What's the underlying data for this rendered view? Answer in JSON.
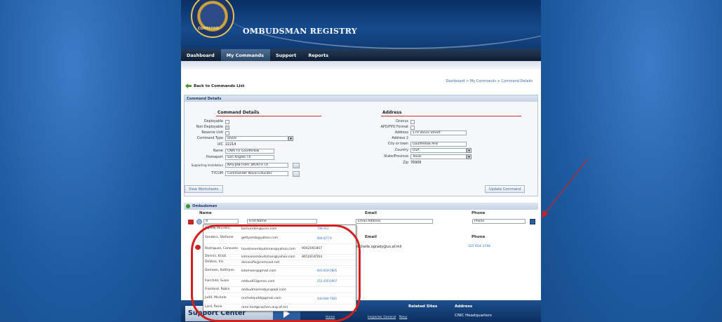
{
  "site": {
    "title": "OMBUDSMAN REGISTRY",
    "seal_text": "COMMAND"
  },
  "nav": {
    "items": [
      "Dashboard",
      "My Commands",
      "Support",
      "Reports"
    ],
    "active": "My Commands"
  },
  "breadcrumb": "Dashboard > My Commands > Command Details",
  "back_link": "Back to Commands List",
  "panel_title": "Command Details",
  "command_details": {
    "section_title": "Command Details",
    "deployable_label": "Deployable",
    "non_deployable_label": "Non-Deployable",
    "reserve_unit_label": "Reserve Unit",
    "command_type_label": "Command Type",
    "command_type_value": "Shore",
    "uic_label": "UIC",
    "uic_value": "22214",
    "name_label": "Name",
    "name_value": "CNATTU Goodfellow",
    "homeport_label": "Homeport",
    "homeport_value": "San Angelo TX",
    "supporting_label": "Supporting Installation",
    "supporting_value": "NAS JRB FORT WORTH TX",
    "tycom_label": "TYCOM",
    "tycom_value": "Commander Naval Educatic"
  },
  "address": {
    "section_title": "Address",
    "oconus_label": "Oconus",
    "apo_label": "APO/FPO Format",
    "address_label": "Address",
    "address_value": "170 Vance Street",
    "address2_label": "Address 2",
    "address2_value": "",
    "city_label": "City or town",
    "city_value": "Goodfellow AFB",
    "country_label": "Country",
    "country_value": "USA",
    "state_label": "State/Province",
    "state_value": "Texas",
    "zip_label": "Zip",
    "zip_value": "76908"
  },
  "buttons": {
    "view_worksheets": "View Worksheets",
    "update_command": "Update Command"
  },
  "ombudsman": {
    "title": "Ombudsman",
    "columns": [
      "Name",
      "Email",
      "Phone"
    ],
    "search_name_value": "d",
    "first_name_placeholder": "First Name",
    "email_placeholder": "Email Address",
    "phone_placeholder": "Phone",
    "existing_email": "michelle.ogrady@us.af.mil",
    "existing_phone": "325 654-3748"
  },
  "dropdown": [
    {
      "name": "Agnew-Munden,",
      "email": "bamunden@juno.com",
      "phone": "798-912"
    },
    {
      "name": "Sanders, Stefanie",
      "email": "gettyomb@yahoo.com",
      "phone": "804-877-9"
    },
    {
      "name": "Rodriguez, Consuela",
      "email": "houstonombudsman@yahoo.com",
      "phone": "9042091857"
    },
    {
      "name": "Dennis, Kristi",
      "email": "kdmoseombudsman@yahoo.com",
      "phone": "8652616564"
    },
    {
      "name": "DeVoss, Iris",
      "email": "devossfis@comcast.net",
      "phone": ""
    },
    {
      "name": "Domsen, Kathlyen",
      "email": "kdomsen@gmail.com",
      "phone": "803-818-0805"
    },
    {
      "name": "Fairchild, Susie",
      "email": "ombud03@msn.com",
      "phone": "251-450-0907"
    },
    {
      "name": "Freeland, Robin",
      "email": "ombudmamrobyn@aol.com",
      "phone": ""
    },
    {
      "name": "Judd, Michele",
      "email": "michelejudd@gmail.com",
      "phone": "540-844-7681"
    },
    {
      "name": "Lord, Rene",
      "email": "rene.lord@cachen.ang.af.mil",
      "phone": ""
    }
  ],
  "footer": {
    "support_center": "Support Center",
    "related_sites": "Related Sites",
    "address_heading": "Address",
    "hq": "CNIC Headquarters",
    "links": [
      "Home",
      "Inspector General",
      "Navy"
    ]
  },
  "colors": {
    "accent_red": "#d2201f",
    "nav_dark": "#0e1e33",
    "link_blue": "#3a6ea5"
  }
}
